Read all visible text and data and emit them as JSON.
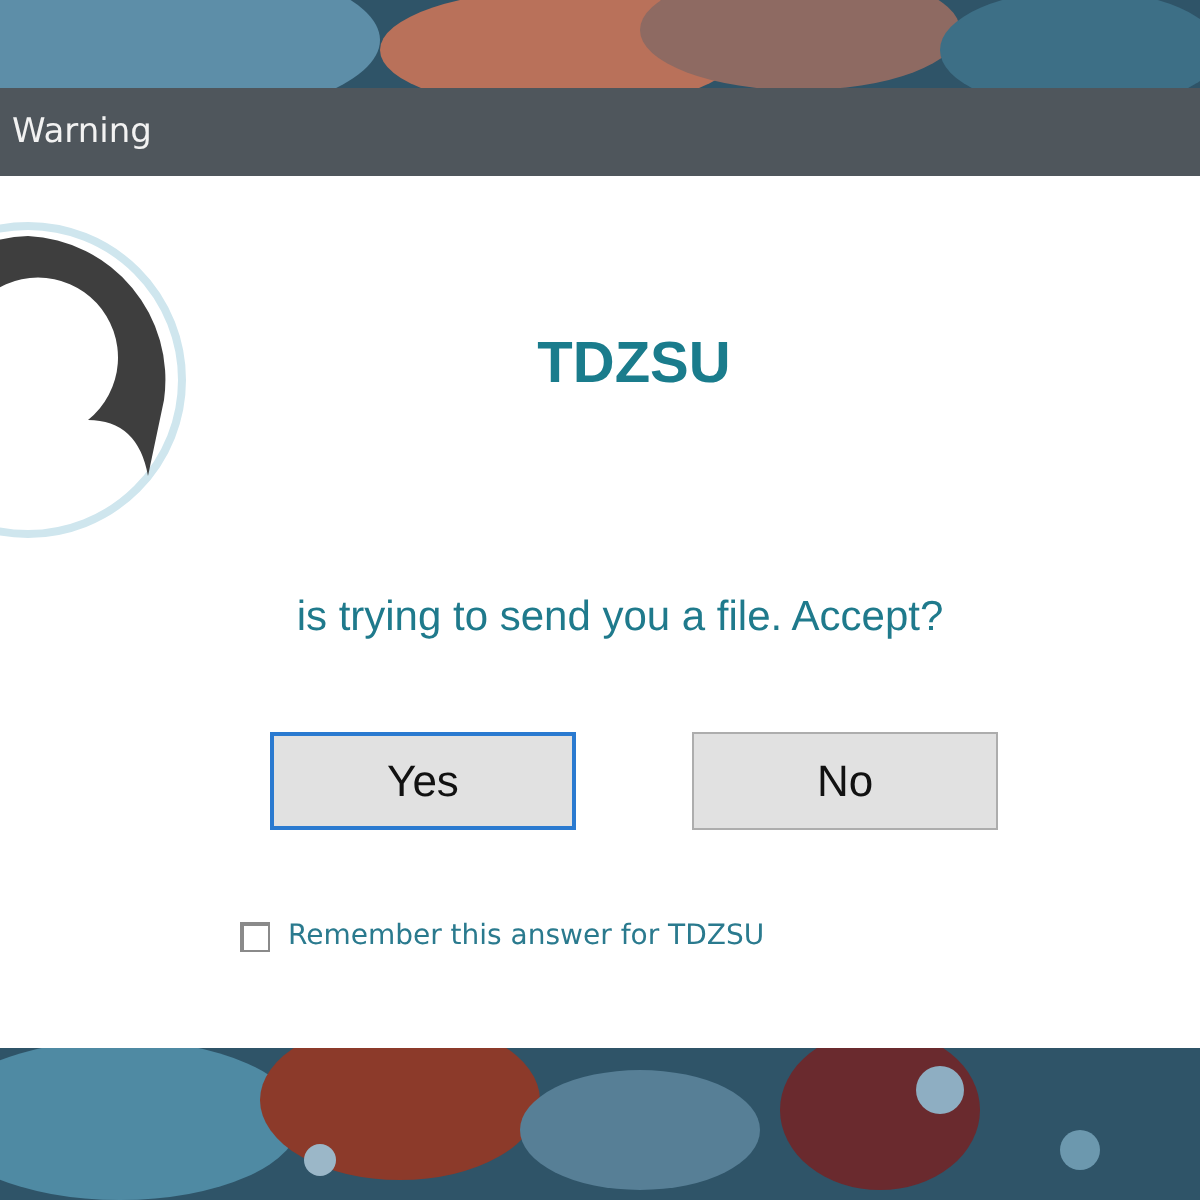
{
  "window": {
    "title": "Warning"
  },
  "dialog": {
    "sender": "TDZSU",
    "message": "is trying to send you a file. Accept?",
    "buttons": [
      {
        "label": "Yes",
        "focused": true
      },
      {
        "label": "No",
        "focused": false
      }
    ],
    "remember": {
      "label": "Remember this answer for TDZSU",
      "checked": false
    }
  }
}
